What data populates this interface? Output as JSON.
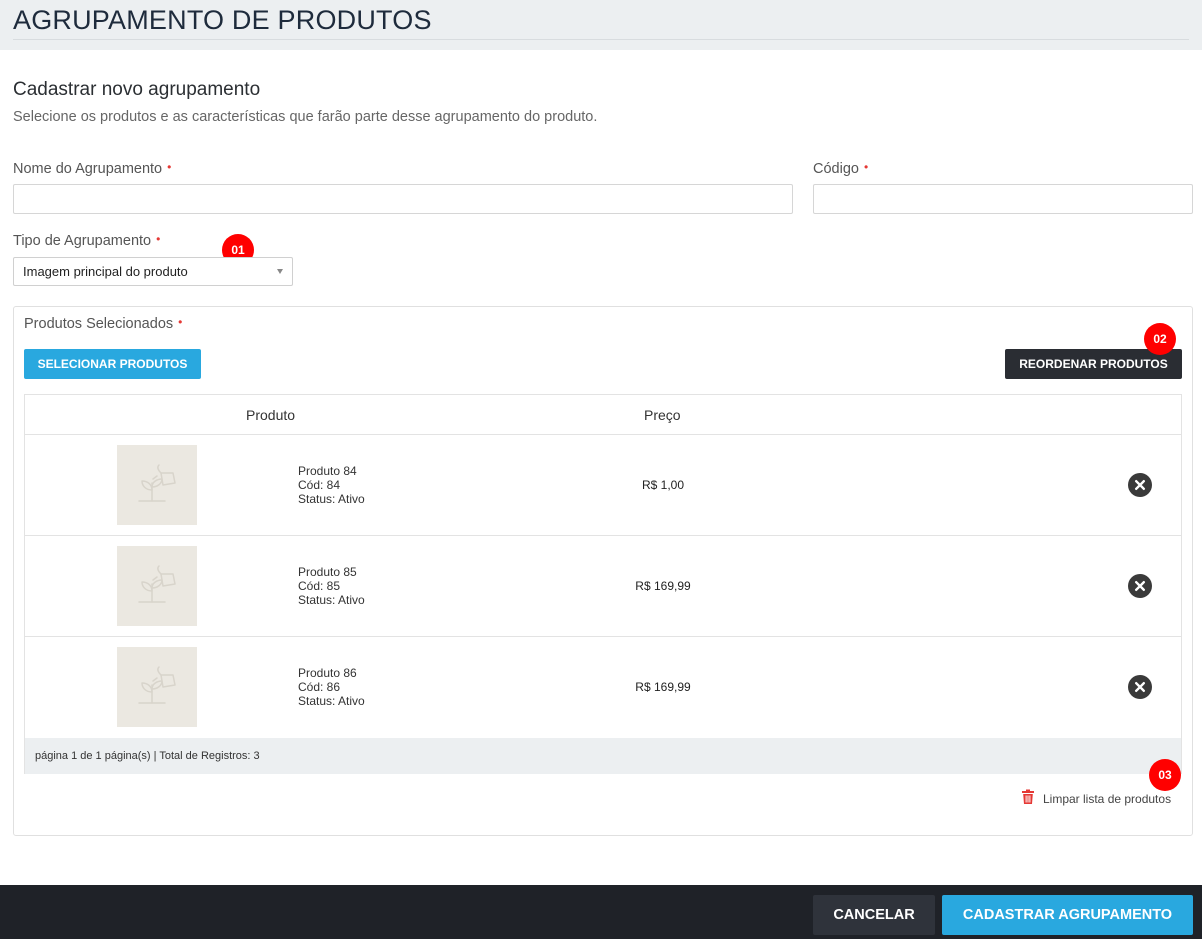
{
  "page": {
    "title": "AGRUPAMENTO DE PRODUTOS"
  },
  "section": {
    "title": "Cadastrar novo agrupamento",
    "subtitle": "Selecione os produtos e as características que farão parte desse agrupamento do produto."
  },
  "form": {
    "nome_label": "Nome do Agrupamento",
    "nome_value": "",
    "codigo_label": "Código",
    "codigo_value": "",
    "tipo_label": "Tipo de Agrupamento",
    "tipo_selected": "Imagem principal do produto",
    "required_mark": "•"
  },
  "badges": {
    "b1": "01",
    "b2": "02",
    "b3": "03"
  },
  "products_panel": {
    "label": "Produtos Selecionados",
    "select_button": "SELECIONAR PRODUTOS",
    "reorder_button": "REORDENAR PRODUTOS",
    "columns": [
      "Produto",
      "Preço"
    ],
    "rows": [
      {
        "name": "Produto 84",
        "code": "Cód: 84",
        "status": "Status: Ativo",
        "price": "R$ 1,00"
      },
      {
        "name": "Produto 85",
        "code": "Cód: 85",
        "status": "Status: Ativo",
        "price": "R$ 169,99"
      },
      {
        "name": "Produto 86",
        "code": "Cód: 86",
        "status": "Status: Ativo",
        "price": "R$ 169,99"
      }
    ],
    "pagination": "página 1 de 1 página(s) | Total de Registros: 3",
    "clear_link": "Limpar lista de produtos"
  },
  "actions": {
    "cancel": "CANCELAR",
    "submit": "CADASTRAR AGRUPAMENTO"
  },
  "colors": {
    "accent": "#29a8df",
    "dark_button": "#2a2d33",
    "badge": "#ff0000",
    "required": "#e53935",
    "trash": "#e53935"
  },
  "icons": {
    "thumb": "product-placeholder-icon",
    "remove": "close-circle-icon",
    "clear": "trash-icon",
    "select_caret": "caret-down-icon"
  }
}
